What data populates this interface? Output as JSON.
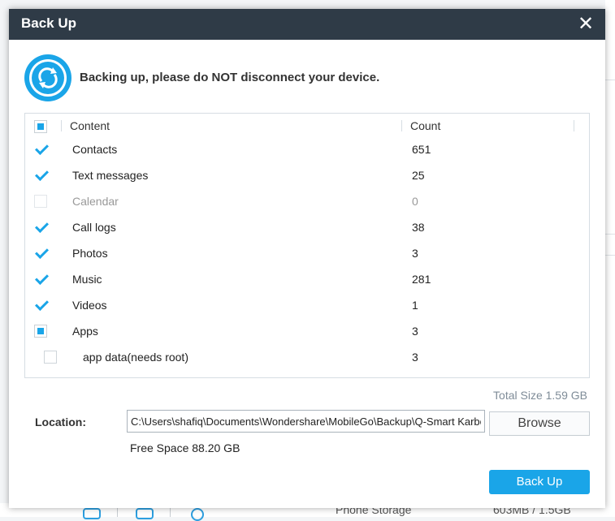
{
  "background": {
    "storage_label": "Phone Storage",
    "storage_value": "603MB / 1.5GB"
  },
  "dialog": {
    "title": "Back Up",
    "close_icon": "close-icon",
    "status_text": "Backing up, please do NOT disconnect your device.",
    "table": {
      "header_content": "Content",
      "header_count": "Count",
      "header_checkbox_state": "partial",
      "rows": [
        {
          "name": "Contacts",
          "count": "651",
          "state": "checked"
        },
        {
          "name": "Text messages",
          "count": "25",
          "state": "checked"
        },
        {
          "name": "Calendar",
          "count": "0",
          "state": "disabled"
        },
        {
          "name": "Call logs",
          "count": "38",
          "state": "checked"
        },
        {
          "name": "Photos",
          "count": "3",
          "state": "checked"
        },
        {
          "name": "Music",
          "count": "281",
          "state": "checked"
        },
        {
          "name": "Videos",
          "count": "1",
          "state": "checked"
        },
        {
          "name": "Apps",
          "count": "3",
          "state": "partial"
        },
        {
          "name": "app data(needs root)",
          "count": "3",
          "state": "empty"
        }
      ]
    },
    "total_size": "Total Size 1.59 GB",
    "location_label": "Location:",
    "location_value": "C:\\Users\\shafiq\\Documents\\Wondershare\\MobileGo\\Backup\\Q-Smart Karbonn",
    "browse_label": "Browse",
    "free_space": "Free Space 88.20 GB",
    "backup_label": "Back Up",
    "colors": {
      "titlebar": "#2f3b47",
      "accent": "#1aa5e8"
    }
  }
}
